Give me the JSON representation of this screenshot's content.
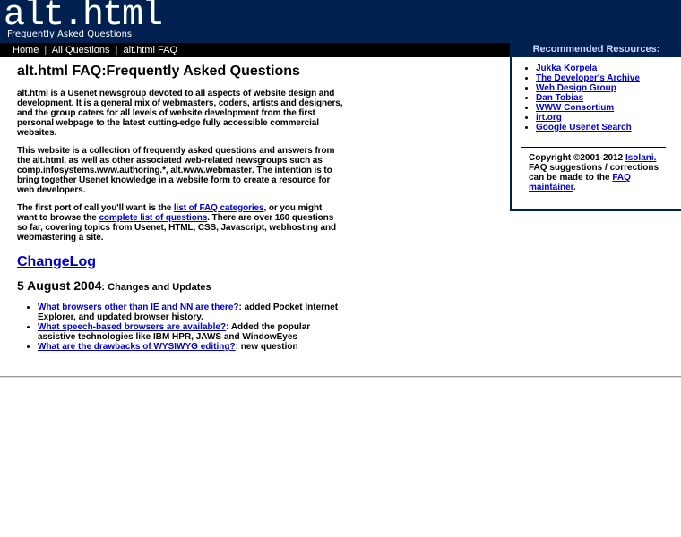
{
  "header": {
    "logo": "alt.html",
    "tagline": "Frequently Asked Questions"
  },
  "nav": {
    "home": "Home",
    "all_questions": "All Questions",
    "faq": "alt.html FAQ",
    "separator": "|"
  },
  "main": {
    "title": "alt.html FAQ:Frequently Asked Questions",
    "p1_strong": "alt.html",
    "p1_rest": " is a Usenet newsgroup devoted to all aspects of website design and development. It is a general mix of webmasters, coders, artists and designers, and the group caters for all levels of website development from the first personal webpage to the latest cutting-edge fully accessible commercial websites.",
    "p2_a": "This website is a collection of frequently asked questions and answers from the ",
    "p2_strong1": "alt.html",
    "p2_b": ", as well as other associated web-related newsgroups such as ",
    "p2_strong2": "comp.infosystems.www.authoring.*",
    "p2_c": ", ",
    "p2_strong3": "alt.www.webmaster",
    "p2_d": ". The intention is to bring together Usenet knowledge in a website form to create a resource for web developers.",
    "p3_a": "The first port of call you'll want is the ",
    "p3_link1": "list of FAQ categories",
    "p3_b": ", or you might want to browse the ",
    "p3_link2": "complete list of questions",
    "p3_c": ". There are over 160 questions so far, covering topics from Usenet, HTML, CSS, Javascript, webhosting and webmastering a site.",
    "changelog_title": "ChangeLog",
    "changelog_date": "5 August 2004",
    "changelog_sub": ": Changes and Updates",
    "changes": [
      {
        "link": "What browsers other than IE and NN are there?",
        "text": ": added Pocket Internet Explorer, and updated browser history."
      },
      {
        "link": "What speech-based browsers are available?",
        "text": ": Added the popular assistive technologies like IBM HPR, JAWS and WindowEyes"
      },
      {
        "link": "What are the drawbacks of WYSIWYG editing?",
        "text": ": new question"
      }
    ]
  },
  "sidebar": {
    "title": "Recommended Resources:",
    "resources": [
      "Jukka Korpela",
      "The Developer's Archive",
      "Web Design Group",
      "Dan Tobias",
      "WWW Consortium",
      "irt.org",
      "Google Usenet Search"
    ],
    "copyright_text": "Copyright ©2001-2012 ",
    "copyright_link": "Isolani.",
    "suggestions_text": "FAQ suggestions / corrections can be made to the ",
    "maintainer_link": "FAQ maintainer",
    "suggestions_end": "."
  }
}
